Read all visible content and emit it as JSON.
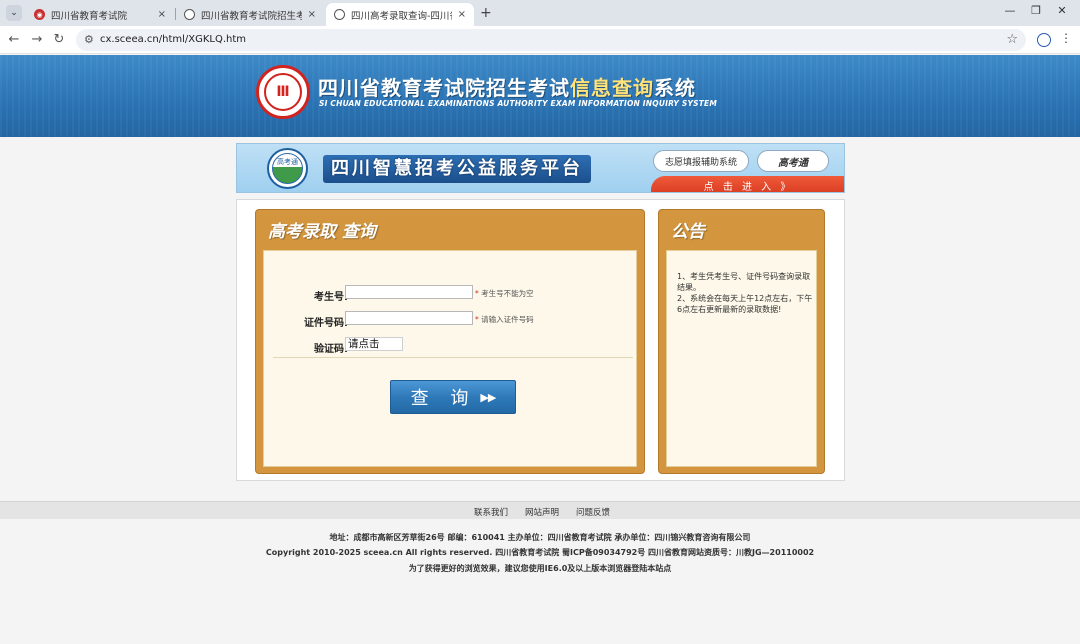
{
  "browser": {
    "tabs": [
      {
        "title": "四川省教育考试院",
        "favicon": "sceea-icon"
      },
      {
        "title": "四川省教育考试院招生考试信息",
        "favicon": "globe-icon"
      },
      {
        "title": "四川高考录取查询-四川省教育",
        "favicon": "globe-icon",
        "active": true
      }
    ],
    "close_glyph": "×",
    "new_tab_glyph": "+",
    "url": "cx.sceea.cn/html/XGKLQ.htm"
  },
  "header": {
    "title_prefix": "四川省教育考试院招生考试",
    "title_highlight": "信息查询",
    "title_suffix": "系统",
    "subtitle": "SI CHUAN EDUCATIONAL EXAMINATIONS AUTHORITY EXAM INFORMATION INQUIRY SYSTEM"
  },
  "banner": {
    "logo_text": "高考通",
    "title": "四川智慧招考公益服务平台",
    "volunteer_button": "志愿填报辅助系统",
    "gaokaotong_button": "高考通",
    "click_text": "点 击 进 入 》"
  },
  "query_panel": {
    "title": "高考录取  查询",
    "exam_no_label": "考生号:",
    "exam_no_value": "",
    "exam_no_hint": "考生号不能为空",
    "id_no_label": "证件号码:",
    "id_no_value": "",
    "id_no_hint": "请输入证件号码",
    "captcha_label": "验证码:",
    "captcha_text": "请点击",
    "hint_star": "*",
    "submit_label": "查 询",
    "submit_arrow": "▶▶"
  },
  "notice_panel": {
    "title": "公告",
    "lines": [
      "1、考生凭考生号、证件号码查询录取结果。",
      "2、系统会在每天上午12点左右，下午6点左右更新最新的录取数据!"
    ]
  },
  "footer": {
    "links": [
      "联系我们",
      "网站声明",
      "问题反馈"
    ],
    "address": "地址：成都市高新区芳草街26号 邮编：610041      主办单位：四川省教育考试院 承办单位：四川锦兴教育咨询有限公司",
    "copyright": "Copyright 2010-2025 sceea.cn All rights reserved. 四川省教育考试院      蜀ICP备09034792号 四川省教育网站资质号：川教JG—20110002",
    "browser_tip": "为了获得更好的浏览效果，建议您使用IE6.0及以上版本浏览器登陆本站点"
  },
  "colors": {
    "header_blue": "#2b74b5",
    "panel_orange": "#d3963f",
    "panel_cream": "#fdf8e9",
    "button_blue": "#2f79b9",
    "accent_red": "#d2231f"
  }
}
